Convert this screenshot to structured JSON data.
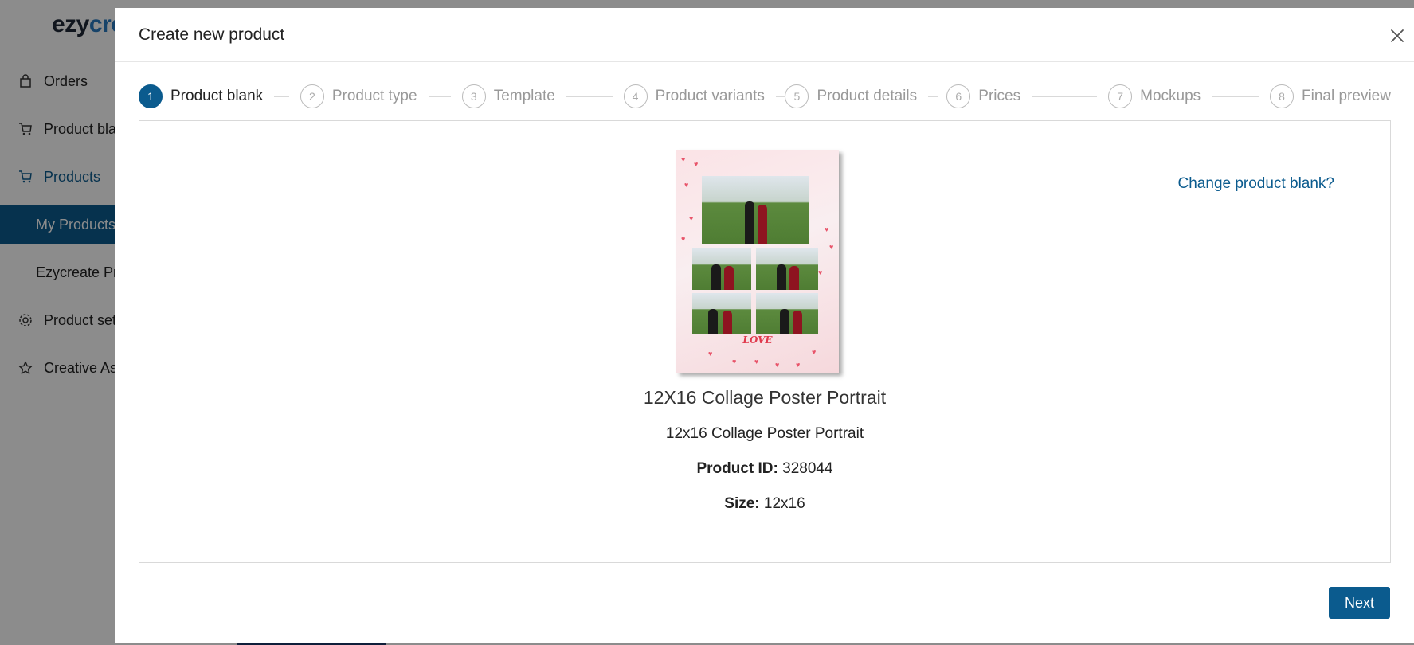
{
  "brand": {
    "part1": "ezy",
    "part2": "cre"
  },
  "sidebar": {
    "items": [
      {
        "label": "Orders",
        "icon": "bag-icon"
      },
      {
        "label": "Product blanks",
        "icon": "cart-icon"
      },
      {
        "label": "Products",
        "icon": "cart-icon"
      },
      {
        "label": "My Products"
      },
      {
        "label": "Ezycreate Products"
      },
      {
        "label": "Product settings",
        "icon": "gear-icon"
      },
      {
        "label": "Creative Assets",
        "icon": "star-icon"
      }
    ]
  },
  "modal": {
    "title": "Create new product",
    "steps": [
      {
        "num": "1",
        "label": "Product blank"
      },
      {
        "num": "2",
        "label": "Product type"
      },
      {
        "num": "3",
        "label": "Template"
      },
      {
        "num": "4",
        "label": "Product variants"
      },
      {
        "num": "5",
        "label": "Product details"
      },
      {
        "num": "6",
        "label": "Prices"
      },
      {
        "num": "7",
        "label": "Mockups"
      },
      {
        "num": "8",
        "label": "Final preview"
      }
    ],
    "current_step": 1,
    "change_link": "Change product blank?",
    "product": {
      "title": "12X16 Collage Poster Portrait",
      "subtitle": "12x16 Collage Poster Portrait",
      "id_label": "Product ID:",
      "id_value": "328044",
      "size_label": "Size:",
      "size_value": "12x16",
      "poster_text": "LOVE"
    },
    "next_label": "Next"
  },
  "colors": {
    "primary": "#0b5b8e",
    "brand_blue": "#2a7bc0"
  }
}
